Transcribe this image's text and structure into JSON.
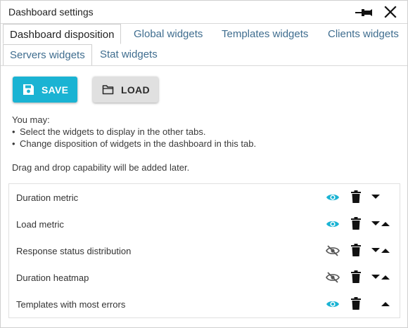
{
  "window": {
    "title": "Dashboard settings",
    "pin_icon": "pin-icon",
    "close_icon": "close-icon"
  },
  "tabs": {
    "row1": [
      {
        "label": "Dashboard disposition",
        "active": true
      },
      {
        "label": "Global widgets",
        "active": false
      },
      {
        "label": "Templates widgets",
        "active": false
      },
      {
        "label": "Clients widgets",
        "active": false
      }
    ],
    "row2": [
      {
        "label": "Servers widgets",
        "active": false
      },
      {
        "label": "Stat widgets",
        "active": false
      }
    ]
  },
  "toolbar": {
    "save_label": "SAVE",
    "save_icon": "floppy-disk-icon",
    "load_label": "LOAD",
    "load_icon": "folder-icon"
  },
  "info": {
    "intro": "You may:",
    "bullets": [
      "Select the widgets to display in the other tabs.",
      "Change disposition of widgets in the dashboard in this tab."
    ],
    "note": "Drag and drop capability will be added later."
  },
  "widgets": [
    {
      "label": "Duration metric",
      "visible": true,
      "can_move_down": true,
      "can_move_up": false
    },
    {
      "label": "Load metric",
      "visible": true,
      "can_move_down": true,
      "can_move_up": true
    },
    {
      "label": "Response status distribution",
      "visible": false,
      "can_move_down": true,
      "can_move_up": true
    },
    {
      "label": "Duration heatmap",
      "visible": false,
      "can_move_down": true,
      "can_move_up": true
    },
    {
      "label": "Templates with most errors",
      "visible": true,
      "can_move_down": false,
      "can_move_up": true
    }
  ],
  "colors": {
    "accent": "#1ab3d3",
    "tab_link": "#3f6d8f",
    "hidden_eye": "#555555"
  }
}
